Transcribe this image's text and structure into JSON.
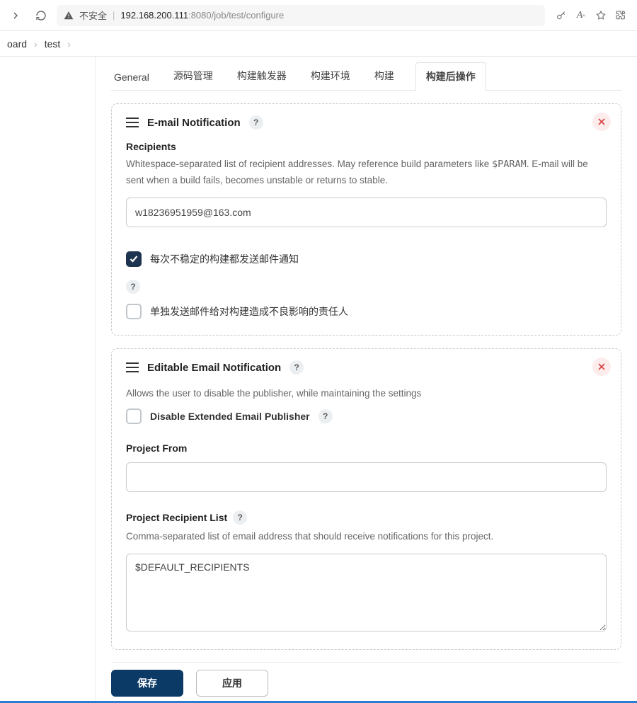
{
  "browser": {
    "insecure_label": "不安全",
    "url_ip": "192.168.200.111",
    "url_port": ":8080",
    "url_path": "/job/test/configure"
  },
  "breadcrumbs": [
    "oard",
    "test"
  ],
  "tabs": [
    "General",
    "源码管理",
    "构建触发器",
    "构建环境",
    "构建",
    "构建后操作"
  ],
  "active_tab_index": 5,
  "section1": {
    "title": "E-mail Notification",
    "recipients_label": "Recipients",
    "recipients_help_pre": "Whitespace-separated list of recipient addresses. May reference build parameters like ",
    "recipients_help_code": "$PARAM",
    "recipients_help_post": ". E-mail will be sent when a build fails, becomes unstable or returns to stable.",
    "recipients_value": "w18236951959@163.com",
    "check1_label": "每次不稳定的构建都发送邮件通知",
    "check1_checked": true,
    "check2_label": "单独发送邮件给对构建造成不良影响的责任人",
    "check2_checked": false
  },
  "section2": {
    "title": "Editable Email Notification",
    "sub_help": "Allows the user to disable the publisher, while maintaining the settings",
    "disable_label": "Disable Extended Email Publisher",
    "disable_checked": false,
    "project_from_label": "Project From",
    "project_from_value": "",
    "recipient_list_label": "Project Recipient List",
    "recipient_list_help": "Comma-separated list of email address that should receive notifications for this project.",
    "recipient_list_value": "$DEFAULT_RECIPIENTS"
  },
  "actions": {
    "save": "保存",
    "apply": "应用"
  }
}
